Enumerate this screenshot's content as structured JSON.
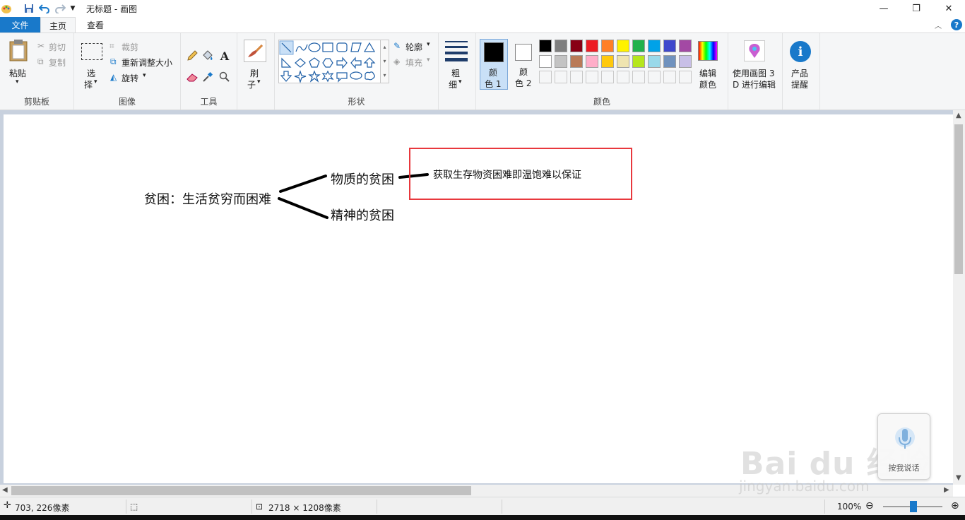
{
  "window": {
    "title": "无标题 - 画图"
  },
  "tabs": {
    "file": "文件",
    "home": "主页",
    "view": "查看"
  },
  "ribbon": {
    "clipboard": {
      "label": "剪贴板",
      "paste": "粘贴",
      "cut": "剪切",
      "copy": "复制"
    },
    "image": {
      "label": "图像",
      "select_line1": "选",
      "select_line2": "择",
      "crop": "裁剪",
      "resize": "重新调整大小",
      "rotate": "旋转"
    },
    "tools": {
      "label": "工具"
    },
    "brushes": {
      "line1": "刷",
      "line2": "子"
    },
    "shapes": {
      "label": "形状",
      "outline": "轮廓",
      "fill": "填充"
    },
    "size": {
      "line1": "粗",
      "line2": "细"
    },
    "colors": {
      "label": "颜色",
      "color1_line1": "颜",
      "color1_line2": "色 1",
      "color2_line1": "颜",
      "color2_line2": "色 2",
      "edit_line1": "编辑",
      "edit_line2": "颜色",
      "palette_row1": [
        "#000000",
        "#7f7f7f",
        "#880015",
        "#ed1c24",
        "#ff7f27",
        "#fff200",
        "#22b14c",
        "#00a2e8",
        "#3f48cc",
        "#a349a4"
      ],
      "palette_row2": [
        "#ffffff",
        "#c3c3c3",
        "#b97a57",
        "#ffaec9",
        "#ffc90e",
        "#efe4b0",
        "#b5e61d",
        "#99d9ea",
        "#7092be",
        "#c8bfe7"
      ]
    },
    "paint3d": {
      "line1": "使用画图 3",
      "line2": "D 进行编辑"
    },
    "tips": {
      "line1": "产品",
      "line2": "提醒"
    }
  },
  "canvas": {
    "main_text": "贫困：生活贫穷而困难",
    "branch1": "物质的贫困",
    "branch2": "精神的贫困",
    "box_text": "获取生存物资困难即温饱难以保证"
  },
  "voice_widget": {
    "label": "按我说话"
  },
  "watermark": {
    "brand": "Bai du 经验",
    "url": "jingyan.baidu.com"
  },
  "status": {
    "cursor_pos": "703, 226像素",
    "canvas_size": "2718 × 1208像素",
    "zoom": "100%"
  }
}
